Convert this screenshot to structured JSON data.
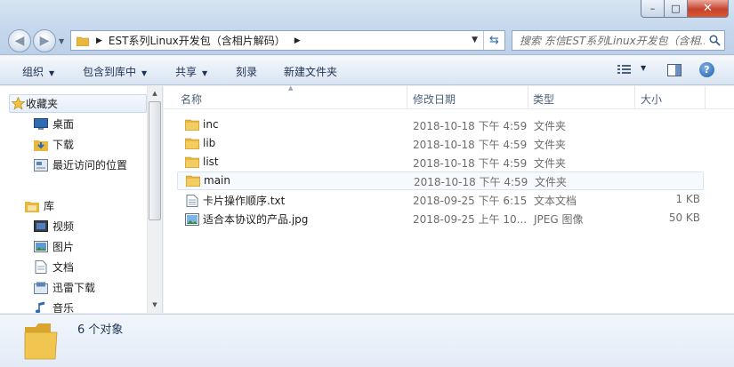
{
  "window": {
    "minimize_label": "–",
    "maximize_label": "□",
    "close_label": "✕"
  },
  "address": {
    "path": "EST系列Linux开发包（含相片解码）"
  },
  "search": {
    "placeholder": "搜索 东信EST系列Linux开发包（含相..."
  },
  "toolbar": {
    "organize": "组织",
    "include_in_library": "包含到库中",
    "share": "共享",
    "burn": "刻录",
    "new_folder": "新建文件夹"
  },
  "sidebar": {
    "favorites": "收藏夹",
    "desktop": "桌面",
    "downloads": "下载",
    "recent": "最近访问的位置",
    "libraries": "库",
    "videos": "视频",
    "pictures": "图片",
    "documents": "文档",
    "xunlei": "迅雷下载",
    "music": "音乐"
  },
  "columns": {
    "name": "名称",
    "modified": "修改日期",
    "type": "类型",
    "size": "大小"
  },
  "files": [
    {
      "name": "inc",
      "date": "2018-10-18 下午 4:59",
      "type": "文件夹",
      "size": "",
      "icon": "folder-icon"
    },
    {
      "name": "lib",
      "date": "2018-10-18 下午 4:59",
      "type": "文件夹",
      "size": "",
      "icon": "folder-icon"
    },
    {
      "name": "list",
      "date": "2018-10-18 下午 4:59",
      "type": "文件夹",
      "size": "",
      "icon": "folder-icon"
    },
    {
      "name": "main",
      "date": "2018-10-18 下午 4:59",
      "type": "文件夹",
      "size": "",
      "icon": "folder-icon"
    },
    {
      "name": "卡片操作顺序.txt",
      "date": "2018-09-25 下午 6:15",
      "type": "文本文档",
      "size": "1 KB",
      "icon": "text-file-icon"
    },
    {
      "name": "适合本协议的产品.jpg",
      "date": "2018-09-25 上午 10...",
      "type": "JPEG 图像",
      "size": "50 KB",
      "icon": "image-file-icon"
    }
  ],
  "details": {
    "count": "6 个对象"
  },
  "colors": {
    "folder": "#e8b73c",
    "accent": "#1f5fae"
  }
}
